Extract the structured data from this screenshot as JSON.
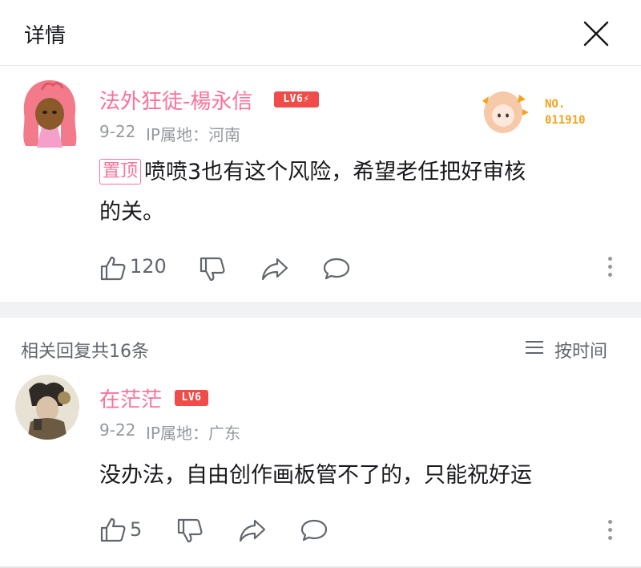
{
  "header": {
    "title": "详情"
  },
  "main_comment": {
    "username": "法外狂徒-楊永信",
    "level": "LV6⚡",
    "date": "9-22",
    "ip_label": "IP属地：河南",
    "pin_label": "置顶",
    "text_line1": "喷喷3也有这个风险，希望老任把好审核",
    "text_line2": "的关。",
    "like_count": "120",
    "fan_badge_number": "NO.\n011910"
  },
  "replies_header": {
    "count_label": "相关回复共16条",
    "sort_label": "按时间"
  },
  "reply": {
    "username": "在茫茫",
    "level": "LV6",
    "date": "9-22",
    "ip_label": "IP属地：广东",
    "text": "没办法，自由创作画板管不了的，只能祝好运",
    "like_count": "5"
  },
  "colors": {
    "accent_pink": "#fb7299",
    "level_red": "#f04c49",
    "meta_gray": "#9499a0"
  }
}
